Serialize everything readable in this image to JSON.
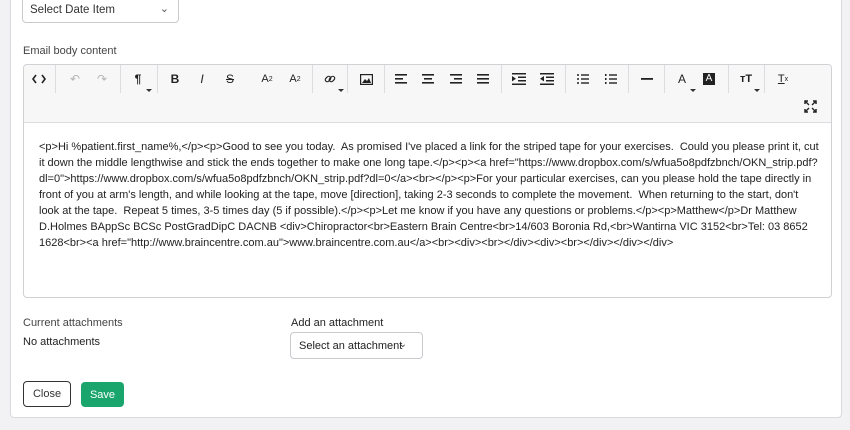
{
  "date_select": {
    "value": "Select Date Item",
    "icon": "chevron-down-icon"
  },
  "email_body": {
    "label": "Email body content",
    "toolbar": [
      {
        "name": "code-view-icon",
        "glyph": "<>"
      },
      {
        "name": "undo-icon",
        "glyph": "↶"
      },
      {
        "name": "redo-icon",
        "glyph": "↷"
      },
      {
        "name": "paragraph-format-icon",
        "glyph": "¶"
      },
      {
        "name": "bold-icon",
        "glyph": "B"
      },
      {
        "name": "italic-icon",
        "glyph": "I"
      },
      {
        "name": "strikethrough-icon",
        "glyph": "S"
      },
      {
        "name": "superscript-icon",
        "glyph": "A²"
      },
      {
        "name": "subscript-icon",
        "glyph": "A₂"
      },
      {
        "name": "insert-link-icon",
        "glyph": "🔗"
      },
      {
        "name": "insert-image-icon",
        "glyph": "▣"
      },
      {
        "name": "align-left-icon",
        "glyph": "≡"
      },
      {
        "name": "align-center-icon",
        "glyph": "≡"
      },
      {
        "name": "align-right-icon",
        "glyph": "≡"
      },
      {
        "name": "align-justify-icon",
        "glyph": "≡"
      },
      {
        "name": "indent-icon",
        "glyph": "⇥"
      },
      {
        "name": "outdent-icon",
        "glyph": "⇤"
      },
      {
        "name": "bullet-list-icon",
        "glyph": "☰"
      },
      {
        "name": "numbered-list-icon",
        "glyph": "☷"
      },
      {
        "name": "horizontal-rule-icon",
        "glyph": "—"
      },
      {
        "name": "font-color-icon",
        "glyph": "A"
      },
      {
        "name": "highlight-color-icon",
        "glyph": "A"
      },
      {
        "name": "font-size-icon",
        "glyph": "TT"
      },
      {
        "name": "clear-format-icon",
        "glyph": "Tx"
      },
      {
        "name": "fullscreen-icon",
        "glyph": "⤢"
      }
    ],
    "content": "<p>Hi %patient.first_name%,</p><p>Good to see you today.  As promised I've placed a link for the striped tape for your exercises.  Could you please print it, cut it down the middle lengthwise and stick the ends together to make one long tape.</p><p><a href=\"https://www.dropbox.com/s/wfua5o8pdfzbnch/OKN_strip.pdf?dl=0\">https://www.dropbox.com/s/wfua5o8pdfzbnch/OKN_strip.pdf?dl=0</a><br></p><p>For your particular exercises, can you please hold the tape directly in front of you at arm's length, and while looking at the tape, move [direction], taking 2-3 seconds to complete the movement.  When returning to the start, don't look at the tape.  Repeat 5 times, 3-5 times day (5 if possible).</p><p>Let me know if you have any questions or problems.</p><p>Matthew</p>Dr Matthew D.Holmes BAppSc BCSc PostGradDipC DACNB <div>Chiropractor<br>Eastern Brain Centre<br>14/603 Boronia Rd,<br>Wantirna VIC 3152<br>Tel: 03 8652 1628<br><a href=\"http://www.braincentre.com.au\">www.braincentre.com.au</a><br><div><br></div><div><br></div></div></div>"
  },
  "attachments": {
    "current_label": "Current attachments",
    "current_value": "No attachments",
    "add_label": "Add an attachment",
    "add_select_value": "Select an attachment"
  },
  "actions": {
    "close_label": "Close",
    "save_label": "Save"
  },
  "colors": {
    "save_button": "#1aa56c",
    "border": "#cfd1d5",
    "toolbar_bg": "#f7f7f8"
  }
}
